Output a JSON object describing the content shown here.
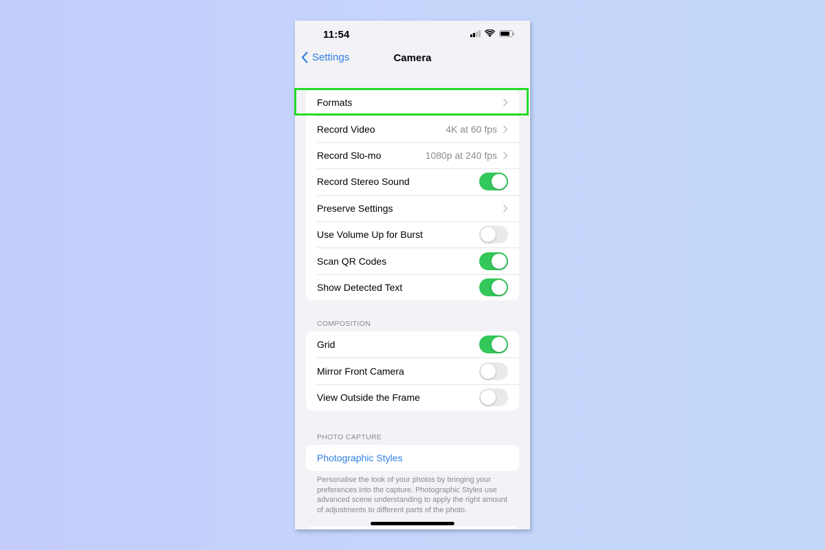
{
  "status_bar": {
    "time": "11:54",
    "icons": [
      "cellular-signal-icon",
      "wifi-icon",
      "battery-icon"
    ]
  },
  "nav": {
    "back_label": "Settings",
    "title": "Camera"
  },
  "main_group": {
    "rows": [
      {
        "label": "Formats",
        "type": "chevron",
        "value": ""
      },
      {
        "label": "Record Video",
        "type": "chevron",
        "value": "4K at 60 fps"
      },
      {
        "label": "Record Slo-mo",
        "type": "chevron",
        "value": "1080p at 240 fps"
      },
      {
        "label": "Record Stereo Sound",
        "type": "toggle",
        "on": true
      },
      {
        "label": "Preserve Settings",
        "type": "chevron",
        "value": ""
      },
      {
        "label": "Use Volume Up for Burst",
        "type": "toggle",
        "on": false
      },
      {
        "label": "Scan QR Codes",
        "type": "toggle",
        "on": true
      },
      {
        "label": "Show Detected Text",
        "type": "toggle",
        "on": true
      }
    ]
  },
  "composition": {
    "header": "COMPOSITION",
    "rows": [
      {
        "label": "Grid",
        "type": "toggle",
        "on": true
      },
      {
        "label": "Mirror Front Camera",
        "type": "toggle",
        "on": false
      },
      {
        "label": "View Outside the Frame",
        "type": "toggle",
        "on": false
      }
    ]
  },
  "photo_capture": {
    "header": "PHOTO CAPTURE",
    "link_label": "Photographic Styles",
    "footer": "Personalise the look of your photos by bringing your preferences into the capture. Photographic Styles use advanced scene understanding to apply the right amount of adjustments to different parts of the photo."
  },
  "highlight": {
    "target": "Formats",
    "color": "#22dd22"
  },
  "colors": {
    "accent": "#2f7fe0",
    "toggle_on": "#34c759",
    "toggle_off": "#e9e9ec",
    "background": "#f2f2f7"
  }
}
